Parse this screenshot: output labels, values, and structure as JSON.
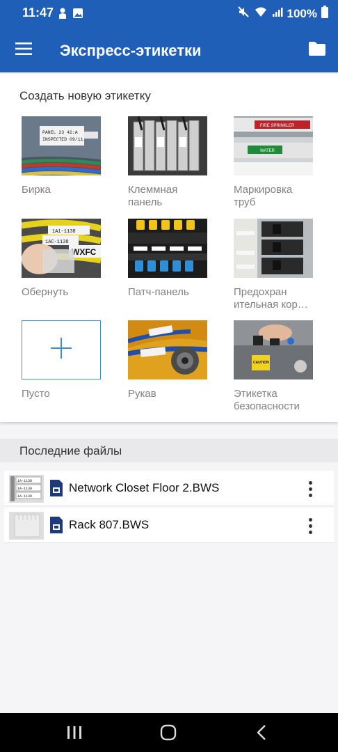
{
  "status_bar": {
    "time": "11:47",
    "battery": "100%"
  },
  "app_bar": {
    "title": "Экспресс-этикетки"
  },
  "templates": {
    "title": "Создать новую этикетку",
    "items": [
      {
        "label": "Бирка"
      },
      {
        "label": "Клеммная панель"
      },
      {
        "label": "Маркировка труб"
      },
      {
        "label": "Обернуть"
      },
      {
        "label": "Патч-панель"
      },
      {
        "label": "Предохран ительная кор…"
      },
      {
        "label": "Пусто"
      },
      {
        "label": "Рукав"
      },
      {
        "label": "Этикетка безопасности"
      }
    ]
  },
  "recent": {
    "title": "Последние файлы",
    "files": [
      {
        "name": "Network Closet Floor 2.BWS"
      },
      {
        "name": "Rack 807.BWS"
      }
    ]
  },
  "photo_text": {
    "tag_line1": "PANEL 23 42:A",
    "tag_line2": "INSPECTED 09/11",
    "pipe_label1": "FIRE SPRINKLER",
    "pipe_label2": "WATER",
    "wrap_text1": "1A1-1138",
    "wrap_text2": "1AC-1138",
    "wrap_text3": "WXFC",
    "safety_text": "CAUTION",
    "thumb_text": "1A-1138"
  },
  "colors": {
    "primary": "#1f5fb7",
    "accent": "#3b8fd0"
  }
}
